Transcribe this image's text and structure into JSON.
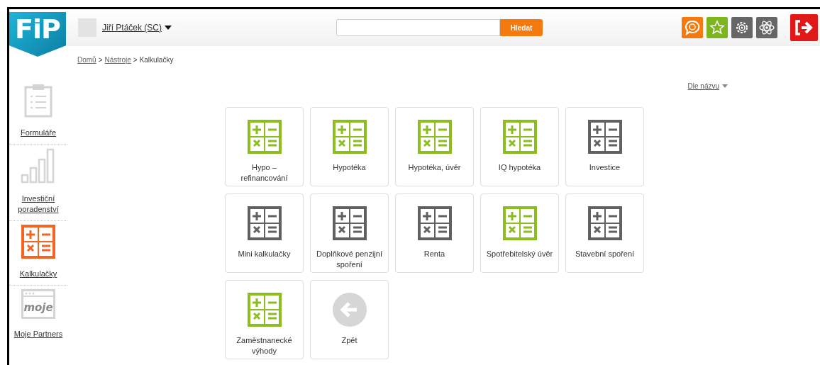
{
  "logo": {
    "text": "FiP"
  },
  "user": {
    "name": "Jiří Ptáček (SC)"
  },
  "search": {
    "button": "Hledat"
  },
  "breadcrumb": [
    {
      "label": "Domů",
      "link": true
    },
    {
      "label": ">",
      "link": false
    },
    {
      "label": "Nástroje",
      "link": true
    },
    {
      "label": ">",
      "link": false
    },
    {
      "label": "Kalkulačky",
      "link": false
    }
  ],
  "sidebar": {
    "items": [
      {
        "kind": "clipboard",
        "label": "Formuláře",
        "selected": false
      },
      {
        "kind": "bars",
        "label": "Investiční poradenství",
        "selected": false
      },
      {
        "kind": "calculator",
        "label": "Kalkulačky",
        "selected": true
      },
      {
        "kind": "window",
        "label": "Moje Partners",
        "icon_text": "moje",
        "selected": false
      }
    ]
  },
  "sort": {
    "label": "Dle názvu"
  },
  "tiles": [
    {
      "kind": "calculator",
      "label": "Hypo – refinancování",
      "color": "#8cbd1e"
    },
    {
      "kind": "calculator",
      "label": "Hypotéka",
      "color": "#8cbd1e"
    },
    {
      "kind": "calculator",
      "label": "Hypotéka, úvěr",
      "color": "#8cbd1e"
    },
    {
      "kind": "calculator",
      "label": "IQ hypotéka",
      "color": "#8cbd1e"
    },
    {
      "kind": "calculator",
      "label": "Investice",
      "color": "#616161"
    },
    {
      "kind": "calculator",
      "label": "Mini kalkulačky",
      "color": "#616161"
    },
    {
      "kind": "calculator",
      "label": "Doplňkové penzijní spoření",
      "color": "#616161"
    },
    {
      "kind": "calculator",
      "label": "Renta",
      "color": "#616161"
    },
    {
      "kind": "calculator",
      "label": "Spotřebitelský úvěr",
      "color": "#8cbd1e"
    },
    {
      "kind": "calculator",
      "label": "Stavební spoření",
      "color": "#616161"
    },
    {
      "kind": "calculator",
      "label": "Zaměstnanecké výhody",
      "color": "#8cbd1e"
    },
    {
      "kind": "back",
      "label": "Zpět",
      "color": "#d6d6d6"
    }
  ]
}
